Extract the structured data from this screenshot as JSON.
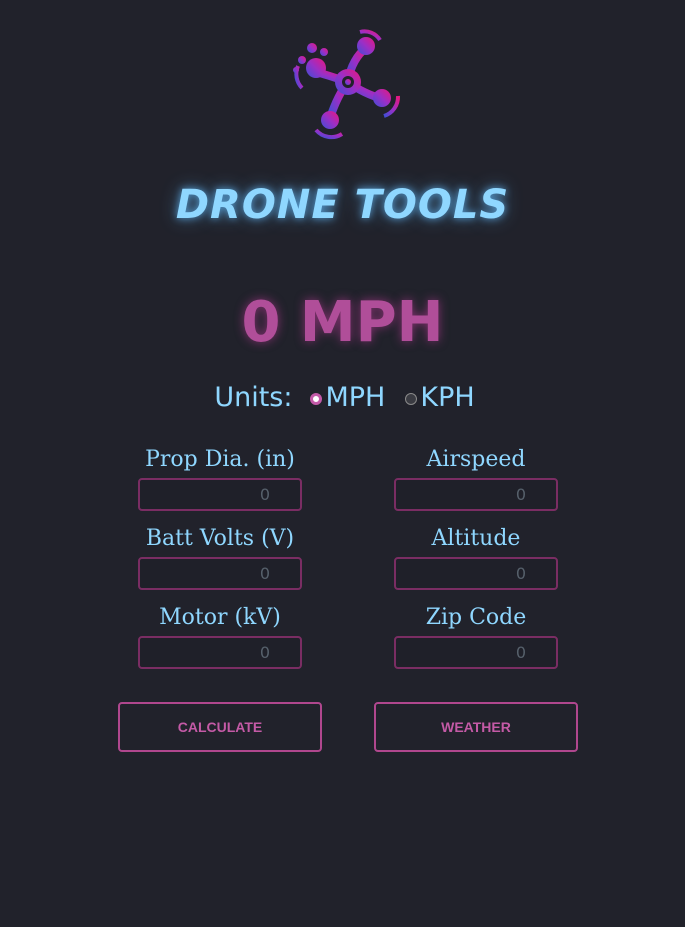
{
  "header": {
    "logo_icon": "drone-quadcopter-logo",
    "title": "DRONE TOOLS"
  },
  "readout": {
    "speed": "0 MPH"
  },
  "units": {
    "label": "Units:",
    "options": [
      {
        "label": "MPH",
        "checked": true
      },
      {
        "label": "KPH",
        "checked": false
      }
    ]
  },
  "fields": {
    "prop_dia": {
      "label": "Prop Dia. (in)",
      "placeholder": "0"
    },
    "batt_volts": {
      "label": "Batt Volts (V)",
      "placeholder": "0"
    },
    "motor_kv": {
      "label": "Motor (kV)",
      "placeholder": "0"
    },
    "airspeed": {
      "label": "Airspeed",
      "placeholder": "0"
    },
    "altitude": {
      "label": "Altitude",
      "placeholder": "0"
    },
    "zip_code": {
      "label": "Zip Code",
      "placeholder": "0"
    }
  },
  "buttons": {
    "calculate": "CALCULATE",
    "weather": "WEATHER"
  },
  "colors": {
    "background": "#21222b",
    "accent_cyan": "#8fd7ff",
    "accent_magenta": "#b04e99",
    "input_border": "#7a2d63"
  }
}
